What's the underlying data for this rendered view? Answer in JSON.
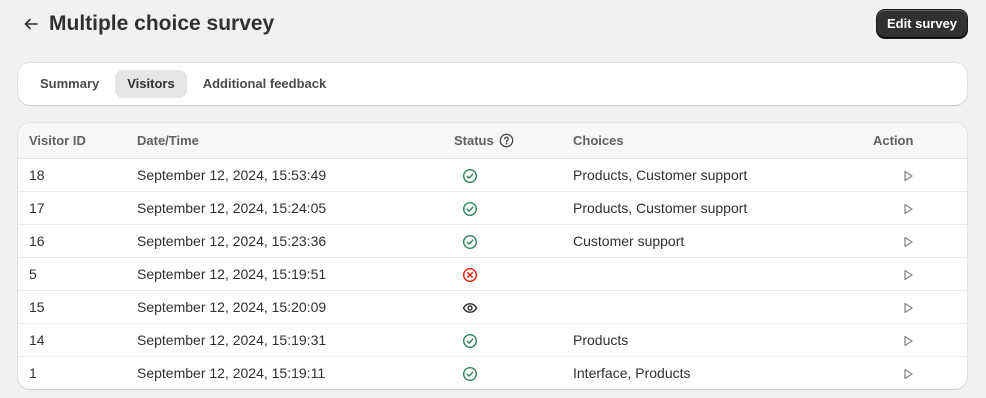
{
  "header": {
    "title": "Multiple choice survey",
    "edit_label": "Edit survey",
    "back_icon": "arrow-left-icon"
  },
  "tabs": [
    {
      "label": "Summary",
      "active": false
    },
    {
      "label": "Visitors",
      "active": true
    },
    {
      "label": "Additional feedback",
      "active": false
    }
  ],
  "table": {
    "columns": {
      "visitor_id": "Visitor ID",
      "datetime": "Date/Time",
      "status": "Status",
      "choices": "Choices",
      "action": "Action"
    },
    "rows": [
      {
        "id": "18",
        "datetime": "September 12, 2024, 15:53:49",
        "status": "completed",
        "choices": "Products, Customer support"
      },
      {
        "id": "17",
        "datetime": "September 12, 2024, 15:24:05",
        "status": "completed",
        "choices": "Products, Customer support"
      },
      {
        "id": "16",
        "datetime": "September 12, 2024, 15:23:36",
        "status": "completed",
        "choices": "Customer support"
      },
      {
        "id": "5",
        "datetime": "September 12, 2024, 15:19:51",
        "status": "dismissed",
        "choices": ""
      },
      {
        "id": "15",
        "datetime": "September 12, 2024, 15:20:09",
        "status": "viewed",
        "choices": ""
      },
      {
        "id": "14",
        "datetime": "September 12, 2024, 15:19:31",
        "status": "completed",
        "choices": "Products"
      },
      {
        "id": "1",
        "datetime": "September 12, 2024, 15:19:11",
        "status": "completed",
        "choices": "Interface, Products"
      }
    ]
  },
  "colors": {
    "completed": "#29845a",
    "dismissed": "#e51c00",
    "viewed": "#303030",
    "action": "#8a8a8a"
  }
}
